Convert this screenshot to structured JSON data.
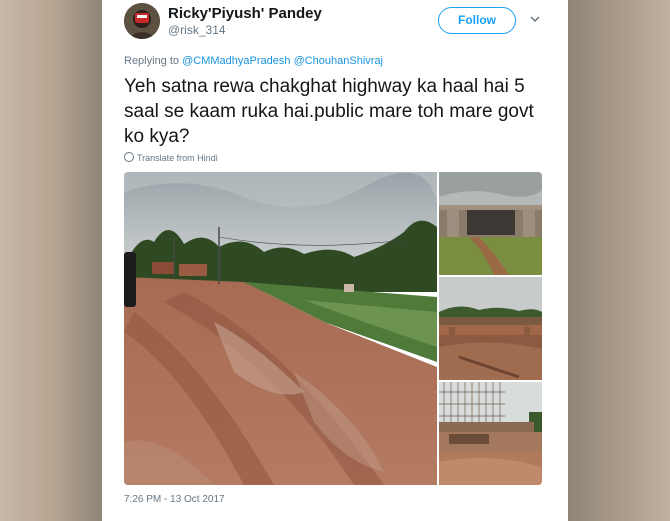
{
  "user": {
    "display_name": "Ricky'Piyush' Pandey",
    "handle": "@risk_314"
  },
  "actions": {
    "follow_label": "Follow",
    "more_icon": "chevron-down-icon"
  },
  "reply": {
    "prefix": "Replying to",
    "mentions": [
      "@CMMadhyaPradesh",
      "@ChouhanShivraj"
    ]
  },
  "tweet": {
    "text": "Yeh satna rewa chakghat highway ka haal hai 5 saal se kaam ruka hai.public mare toh mare govt ko kya?",
    "translate_label": "Translate from Hindi",
    "translate_icon": "globe-icon",
    "timestamp": "7:26 PM - 13 Oct 2017"
  },
  "colors": {
    "accent": "#1da1f2",
    "text": "#14171a",
    "muted": "#657786",
    "mention": "#1b95e0"
  }
}
